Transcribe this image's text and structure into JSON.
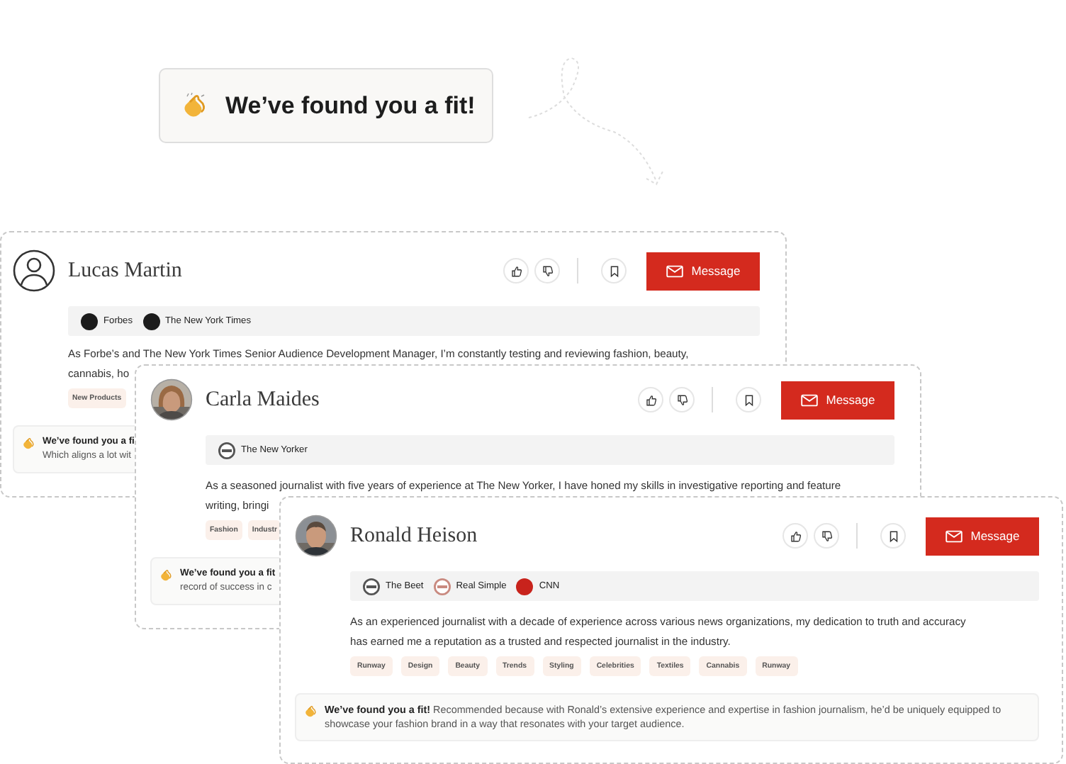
{
  "banner": {
    "title": "We’ve found you a fit!"
  },
  "cards": [
    {
      "name": "Lucas Martin",
      "avatar": {
        "kind": "placeholder"
      },
      "outlets": [
        {
          "name": "Forbes",
          "kind": "filled",
          "color": "#1c1c1c"
        },
        {
          "name": "The New York Times",
          "kind": "filled",
          "color": "#1c1c1c"
        }
      ],
      "description": [
        "As Forbe’s and The New York Times Senior Audience Development Manager, I’m constantly testing and reviewing fashion, beauty,",
        "cannabis, ho"
      ],
      "tags": [
        "New Products"
      ],
      "fit": [
        "**We’ve found you a fi**",
        "Which aligns a lot wit"
      ],
      "button": "Message"
    },
    {
      "name": "Carla Maides",
      "avatar": {
        "kind": "picture"
      },
      "outlets": [
        {
          "name": "The New Yorker",
          "kind": "outline",
          "color": "#555555"
        }
      ],
      "description": [
        "As a seasoned journalist with five years of experience at The New Yorker, I have honed my skills in investigative reporting and feature",
        "writing, bringi"
      ],
      "tags": [
        "Fashion",
        "Industr"
      ],
      "fit": [
        "**We’ve found you a fit**",
        "record of success in c"
      ],
      "button": "Message"
    },
    {
      "name": "Ronald Heison",
      "avatar": {
        "kind": "picture"
      },
      "outlets": [
        {
          "name": "The Beet",
          "kind": "outline",
          "color": "#555555"
        },
        {
          "name": "Real Simple",
          "kind": "outline",
          "color": "#c98a80"
        },
        {
          "name": "CNN",
          "kind": "filled",
          "color": "#c8231c"
        }
      ],
      "description": [
        "As an experienced journalist with a decade of experience across various news organizations, my dedication to truth and accuracy",
        "has earned me a reputation as a trusted and respected journalist in the industry."
      ],
      "tags": [
        "Runway",
        "Design",
        "Beauty",
        "Trends",
        "Styling",
        "Celebrities",
        "Textiles",
        "Cannabis",
        "Runway"
      ],
      "fit": [
        "**We’ve found you a fit!** Recommended because with Ronald’s extensive experience and expertise in fashion journalism, he’d be uniquely equipped to",
        "showcase your fashion brand in a way that resonates with your target audience."
      ],
      "button": "Message"
    }
  ]
}
